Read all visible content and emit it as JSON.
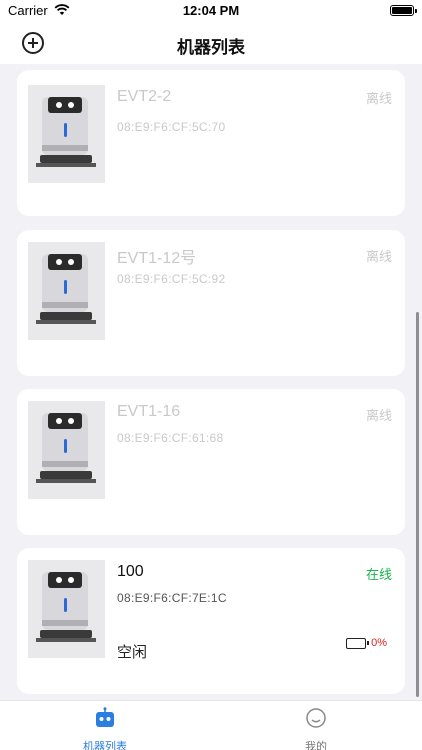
{
  "status_bar": {
    "carrier": "Carrier",
    "time": "12:04 PM"
  },
  "nav": {
    "title": "机器列表"
  },
  "robots": [
    {
      "name": "EVT2-2",
      "mac": "08:E9:F6:CF:5C:70",
      "status": "离线",
      "online": false
    },
    {
      "name": "EVT1-12号",
      "mac": "08:E9:F6:CF:5C:92",
      "status": "离线",
      "online": false
    },
    {
      "name": "EVT1-16",
      "mac": "08:E9:F6:CF:61:68",
      "status": "离线",
      "online": false
    },
    {
      "name": "100",
      "mac": "08:E9:F6:CF:7E:1C",
      "status": "在线",
      "online": true,
      "work_state": "空闲",
      "battery": "0%"
    }
  ],
  "tabs": [
    {
      "label": "机器列表",
      "icon": "robot-icon",
      "active": true
    },
    {
      "label": "我的",
      "icon": "smiley-icon",
      "active": false
    }
  ],
  "colors": {
    "active_tab": "#2a7de1",
    "online": "#17b34a",
    "offline": "#c9c9cc",
    "battery_low": "#e02020"
  }
}
